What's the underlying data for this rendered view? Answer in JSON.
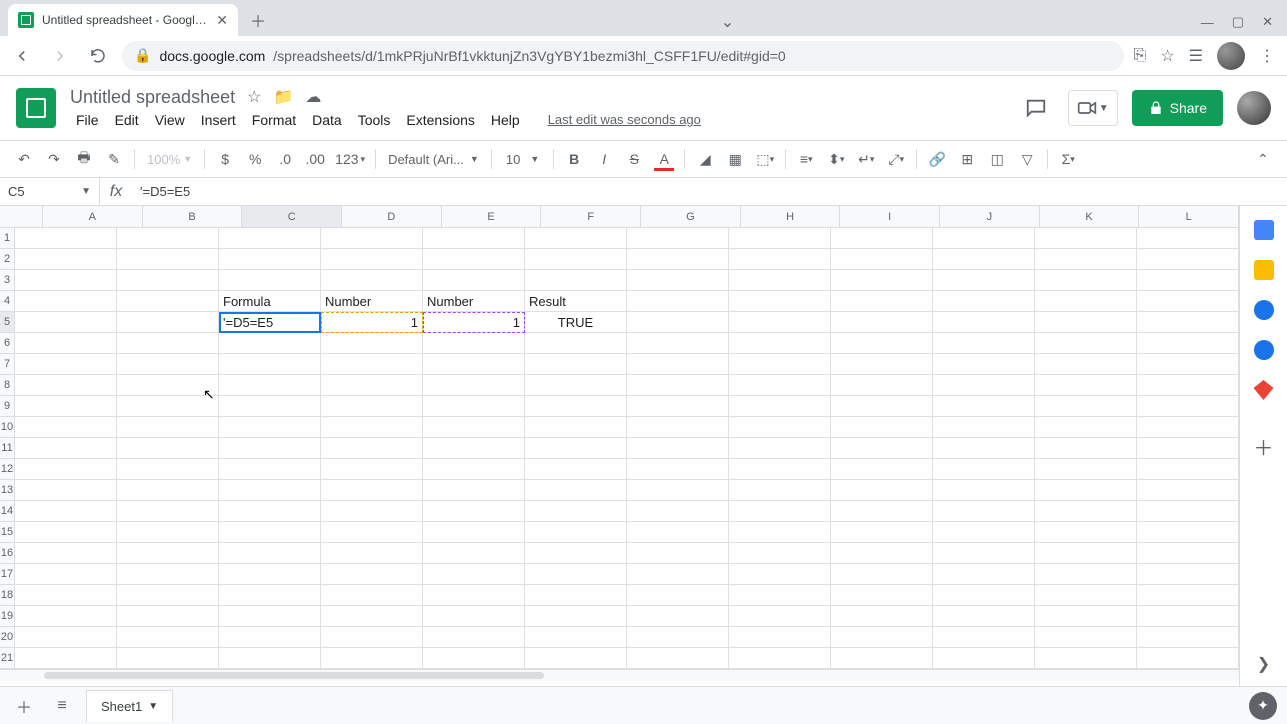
{
  "browser": {
    "tab_title": "Untitled spreadsheet - Google S",
    "url_domain": "docs.google.com",
    "url_path": "/spreadsheets/d/1mkPRjuNrBf1vkktunjZn3VgYBY1bezmi3hl_CSFF1FU/edit#gid=0"
  },
  "doc": {
    "title": "Untitled spreadsheet",
    "last_edit": "Last edit was seconds ago",
    "menus": [
      "File",
      "Edit",
      "View",
      "Insert",
      "Format",
      "Data",
      "Tools",
      "Extensions",
      "Help"
    ],
    "share_label": "Share"
  },
  "toolbar": {
    "zoom": "100%",
    "format_123": "123",
    "font": "Default (Ari...",
    "font_size": "10"
  },
  "fx": {
    "cell_ref": "C5",
    "formula": "'=D5=E5"
  },
  "grid": {
    "columns": [
      "A",
      "B",
      "C",
      "D",
      "E",
      "F",
      "G",
      "H",
      "I",
      "J",
      "K",
      "L"
    ],
    "row_count": 21,
    "selected_cell": "C5",
    "headers_row": 4,
    "data_row": 5,
    "content": {
      "C4": "Formula",
      "D4": "Number",
      "E4": "Number",
      "F4": "Result",
      "C5": "'=D5=E5",
      "D5": "1",
      "E5": "1",
      "F5": "TRUE"
    }
  },
  "sheets": {
    "active": "Sheet1"
  }
}
